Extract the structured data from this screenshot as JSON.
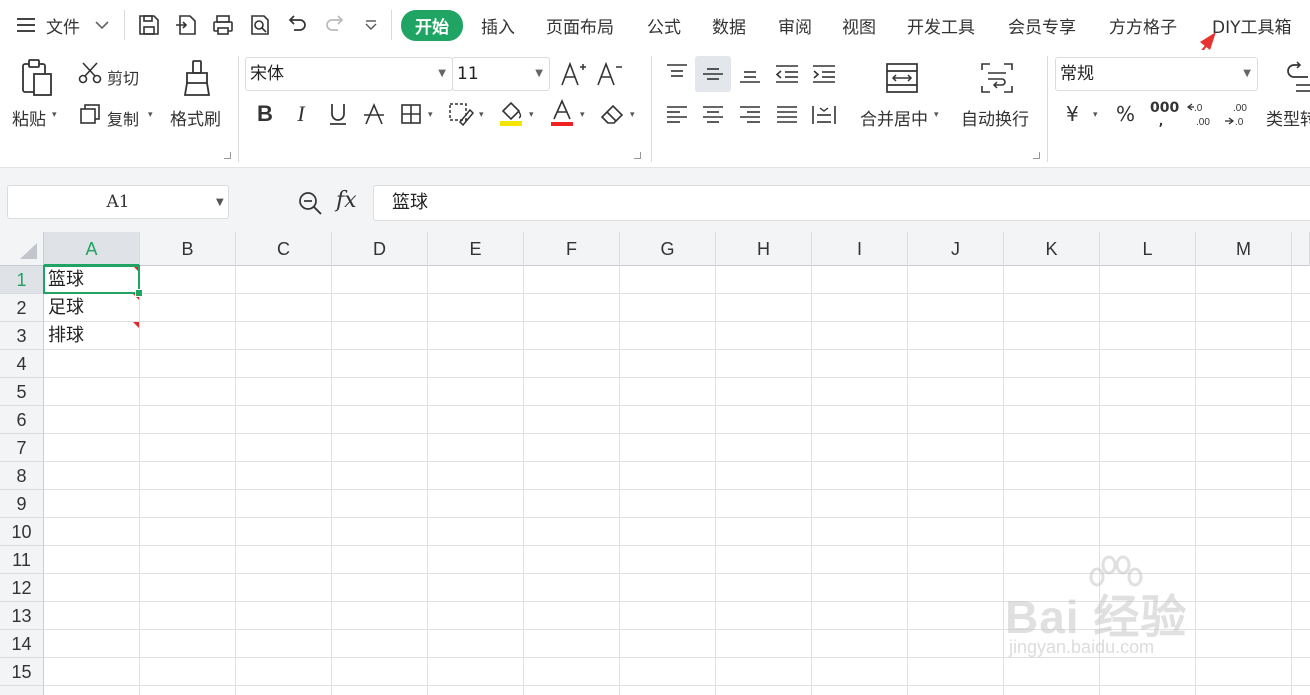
{
  "menu": {
    "file_label": "文件",
    "tabs": [
      "开始",
      "插入",
      "页面布局",
      "公式",
      "数据",
      "审阅",
      "视图",
      "开发工具",
      "会员专享",
      "方方格子",
      "DIY工具箱"
    ]
  },
  "ribbon": {
    "clipboard": {
      "paste": "粘贴",
      "cut": "剪切",
      "copy": "复制",
      "format_painter": "格式刷"
    },
    "font": {
      "name": "宋体",
      "size": "11"
    },
    "alignment": {
      "merge_center": "合并居中",
      "wrap_text": "自动换行"
    },
    "number": {
      "format": "常规",
      "currency": "¥",
      "percent": "%",
      "thousands": "000",
      "type_convert": "类型转"
    }
  },
  "formula_bar": {
    "cell_ref": "A1",
    "fx": "fx",
    "content": "篮球"
  },
  "sheet": {
    "columns": [
      "A",
      "B",
      "C",
      "D",
      "E",
      "F",
      "G",
      "H",
      "I",
      "J",
      "K",
      "L",
      "M"
    ],
    "rows": [
      "1",
      "2",
      "3",
      "4",
      "5",
      "6",
      "7",
      "8",
      "9",
      "10",
      "11",
      "12",
      "13",
      "14",
      "15"
    ],
    "cells": {
      "A1": "篮球",
      "A2": "足球",
      "A3": "排球"
    },
    "selected_cell": "A1"
  },
  "watermark": {
    "brand": "Bai 经验",
    "url": "jingyan.baidu.com"
  },
  "colors": {
    "accent": "#1fa463",
    "comment_marker": "#e2282c",
    "annotation_arrow": "#e8322f"
  }
}
